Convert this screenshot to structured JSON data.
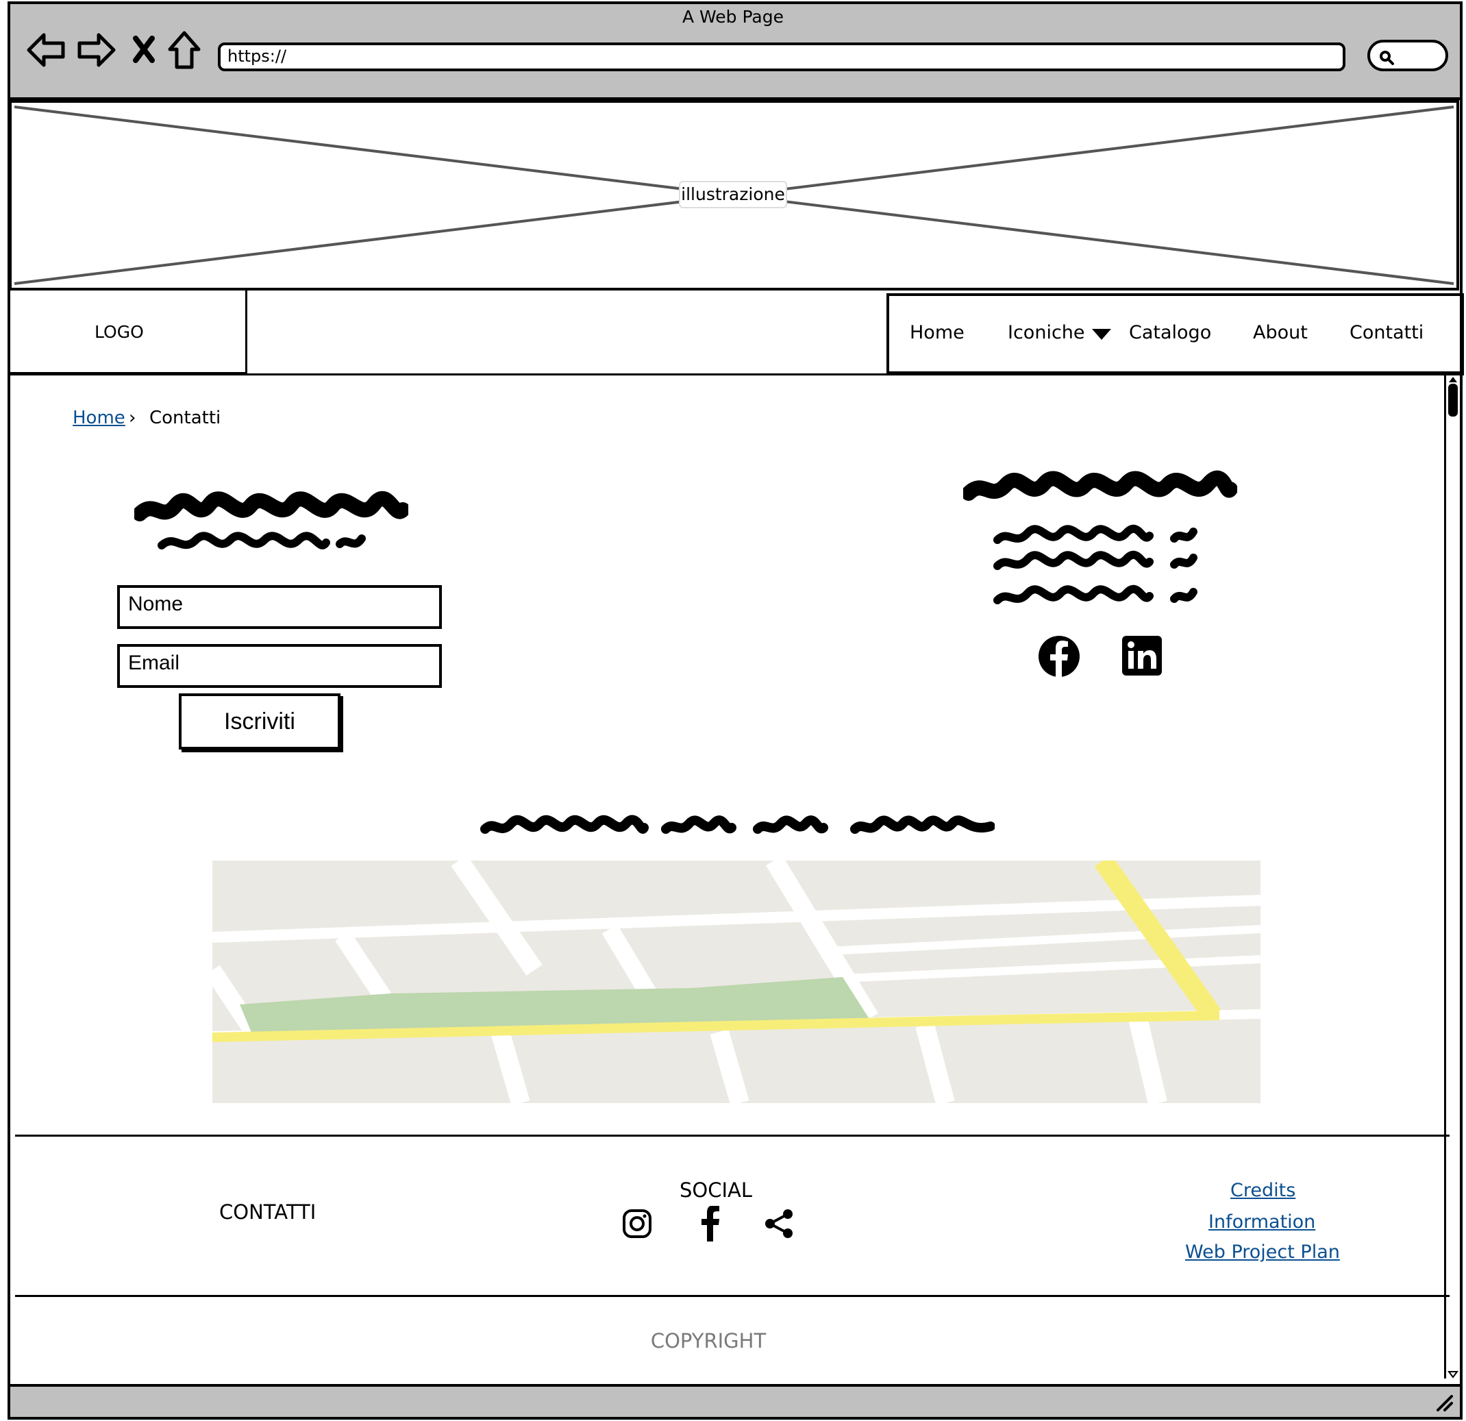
{
  "browser": {
    "title": "A Web Page",
    "url": "https://",
    "nav_icons": [
      "back-arrow-icon",
      "forward-arrow-icon",
      "close-x-icon",
      "home-icon"
    ],
    "search_icon": "search-icon"
  },
  "illustration": {
    "label": "illustrazione"
  },
  "header": {
    "logo": "LOGO",
    "nav": [
      {
        "label": "Home"
      },
      {
        "label": "Iconiche",
        "dropdown_icon": "caret-down-icon"
      },
      {
        "label": "Catalogo"
      },
      {
        "label": "About"
      },
      {
        "label": "Contatti"
      }
    ]
  },
  "breadcrumb": {
    "home": "Home",
    "separator": "›",
    "current": "Contatti"
  },
  "form": {
    "name_placeholder": "Nome",
    "email_placeholder": "Email",
    "submit_label": "Iscriviti"
  },
  "contact_info": {
    "social_icons": [
      "facebook-icon",
      "linkedin-icon"
    ]
  },
  "footer": {
    "contacts_heading": "CONTATTI",
    "social_heading": "SOCIAL",
    "social_icons": [
      "instagram-icon",
      "facebook-icon",
      "share-icon"
    ],
    "links": [
      "Credits",
      "Information",
      "Web Project Plan"
    ],
    "copyright": "COPYRIGHT"
  },
  "colors": {
    "chrome": "#c0c0c0",
    "link": "#0b4f91",
    "map_land": "#ebe9e3",
    "map_park": "#bcd6ad",
    "map_highway": "#f7ee7a"
  }
}
